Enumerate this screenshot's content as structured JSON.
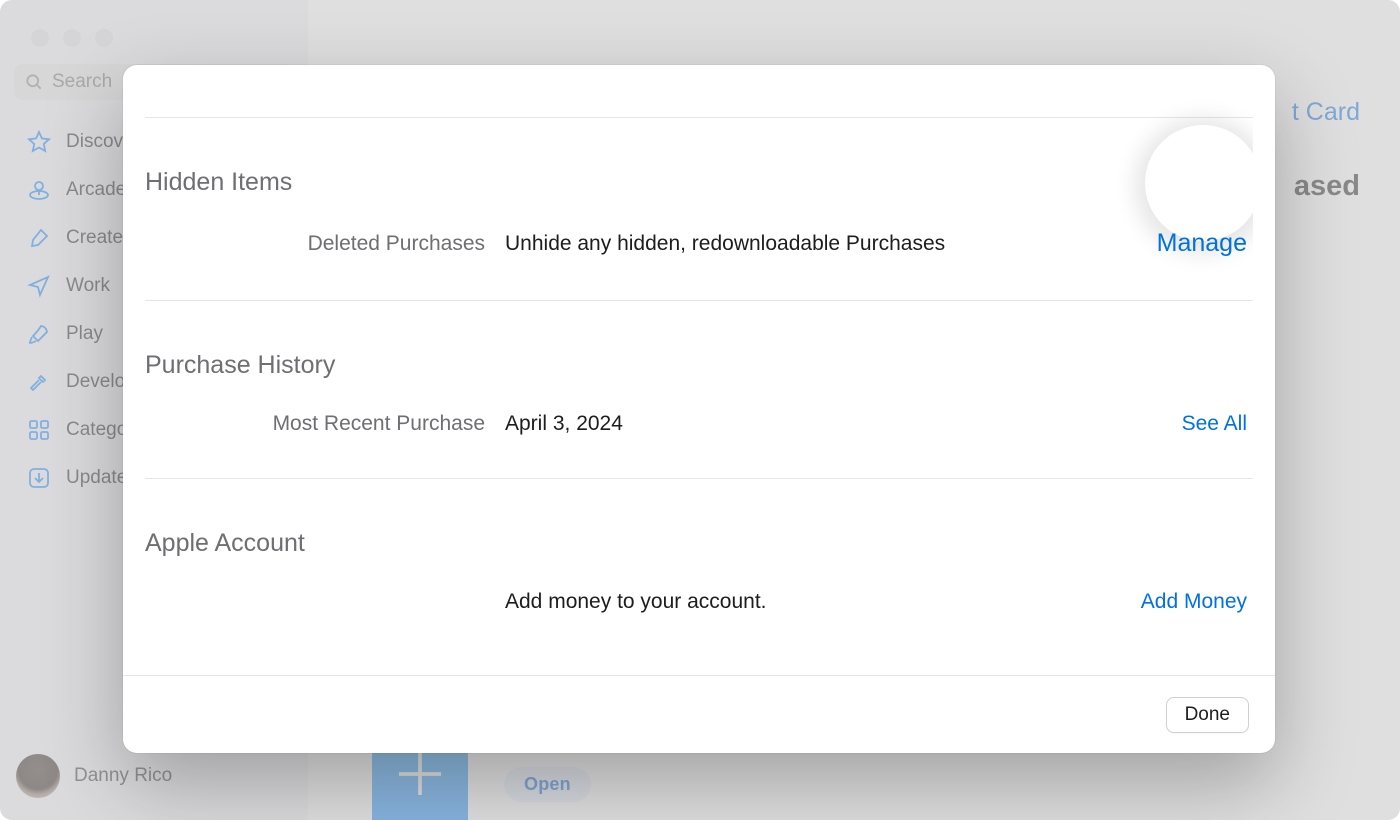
{
  "window": {
    "search_placeholder": "Search"
  },
  "sidebar": {
    "items": [
      {
        "label": "Discover"
      },
      {
        "label": "Arcade"
      },
      {
        "label": "Create"
      },
      {
        "label": "Work"
      },
      {
        "label": "Play"
      },
      {
        "label": "Develop"
      },
      {
        "label": "Categories"
      },
      {
        "label": "Updates"
      }
    ]
  },
  "profile": {
    "name": "Danny Rico"
  },
  "background": {
    "top_right_link": "t Card",
    "purchased_label": "ased",
    "open_button": "Open"
  },
  "modal": {
    "hidden_items": {
      "heading": "Hidden Items",
      "row_label": "Deleted Purchases",
      "row_value": "Unhide any hidden, redownloadable Purchases",
      "action": "Manage"
    },
    "purchase_history": {
      "heading": "Purchase History",
      "row_label": "Most Recent Purchase",
      "row_value": "April 3, 2024",
      "action": "See All"
    },
    "apple_account": {
      "heading": "Apple Account",
      "row_value": "Add money to your account.",
      "action": "Add Money"
    },
    "done": "Done"
  }
}
